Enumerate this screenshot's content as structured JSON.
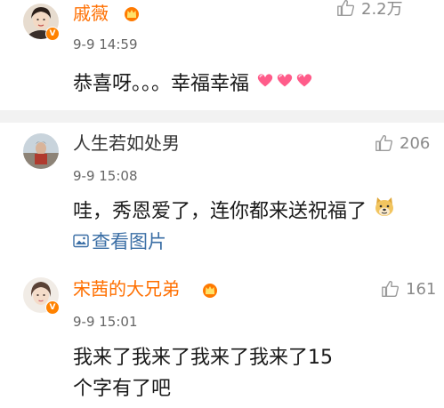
{
  "comments": [
    {
      "username": "戚薇",
      "time": "9-9 14:59",
      "likes": "2.2万",
      "text": "恭喜呀。。。幸福幸福",
      "emojis": [
        "heart-emoji",
        "heart-emoji",
        "heart-emoji"
      ],
      "verified": true,
      "vip": true
    },
    {
      "username": "人生若如处男",
      "time": "9-9 15:08",
      "likes": "206",
      "text": "哇，秀恩爱了，连你都来送祝福了",
      "emojis": [
        "doge-emoji"
      ],
      "link": "查看图片",
      "verified": false,
      "vip": false
    },
    {
      "username": "宋茜的大兄弟",
      "time": "9-9 15:01",
      "likes": "161",
      "text_line1": "我来了我来了我来了我来了15",
      "text_line2": "个字有了吧",
      "verified": true,
      "vip": true
    }
  ],
  "colors": {
    "vip_name": "#ff6f00",
    "normal_name": "#333333",
    "time": "#666666",
    "like": "#8a8a8a",
    "link": "#3a6ea5",
    "divider": "#f2f2f2",
    "verified_badge": "#ff8200"
  },
  "icons": {
    "like": "thumb-up-icon",
    "vip": "crown-badge-icon",
    "verified": "verified-v-icon",
    "picture": "image-icon"
  }
}
